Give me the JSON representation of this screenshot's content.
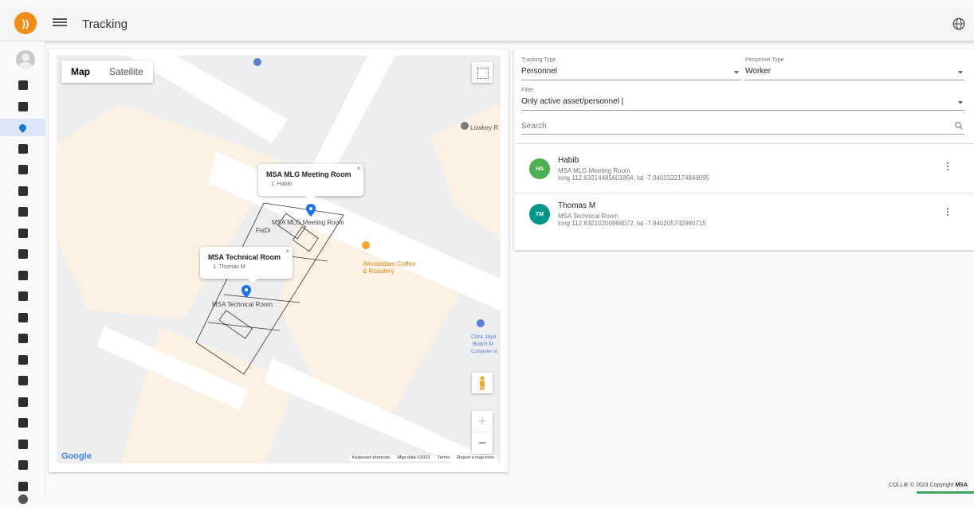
{
  "header": {
    "title": "Tracking",
    "logo_text": "))",
    "menu_icon": "hamburger-menu-icon",
    "language_icon": "globe-icon"
  },
  "sidebar": {
    "items": [
      {
        "icon": "dashboard-icon",
        "active": false
      },
      {
        "icon": "monitor-icon",
        "active": false
      },
      {
        "icon": "location-pin-icon",
        "active": true
      },
      {
        "icon": "floor-plan-icon",
        "active": false
      },
      {
        "icon": "group-icon",
        "active": false
      },
      {
        "icon": "database-icon",
        "active": false
      },
      {
        "icon": "library-icon",
        "active": false
      },
      {
        "icon": "building-icon",
        "active": false
      },
      {
        "icon": "zone-icon",
        "active": false
      },
      {
        "icon": "person-icon",
        "active": false
      },
      {
        "icon": "org-icon",
        "active": false
      },
      {
        "icon": "apartment-icon",
        "active": false
      },
      {
        "icon": "device-icon",
        "active": false
      },
      {
        "icon": "support-icon",
        "active": false
      },
      {
        "icon": "person-check-icon",
        "active": false
      },
      {
        "icon": "person-alert-icon",
        "active": false
      },
      {
        "icon": "person-settings-icon",
        "active": false
      },
      {
        "icon": "people-icon",
        "active": false
      },
      {
        "icon": "walking-icon",
        "active": false
      },
      {
        "icon": "person-more-icon",
        "active": false
      },
      {
        "icon": "help-icon",
        "active": false
      }
    ],
    "accent": "#1976d2"
  },
  "map": {
    "type_options": [
      "Map",
      "Satellite"
    ],
    "selected_type": "Map",
    "popups": [
      {
        "title": "MSA MLG Meeting Room",
        "subtitle": "1. Habib",
        "close": "×"
      },
      {
        "title": "MSA Technical Room",
        "subtitle": "1. Thomas M",
        "close": "×"
      }
    ],
    "labels": {
      "meeting_room": "MSA MLG Meeting Room",
      "technical_room": "MSA Technical Room",
      "fixdi": "FixDi",
      "lowkey": "Lowkey R",
      "amsterdam_1": "Amsterdam Coffee",
      "amsterdam_2": "& Roastery",
      "citra_1": "Citra Jaya",
      "citra_2": "Brach M",
      "citra_3": "Computer st"
    },
    "zoom_in": "+",
    "zoom_out": "−",
    "google_logo": "Google",
    "attribution": {
      "shortcuts": "Keyboard shortcuts",
      "data": "Map data ©2023",
      "terms": "Terms",
      "report": "Report a map error"
    }
  },
  "panel": {
    "tracking_type": {
      "label": "Tracking Type",
      "value": "Personnel"
    },
    "personnel_type": {
      "label": "Personnel Type",
      "value": "Worker"
    },
    "filter": {
      "label": "Filter",
      "value": "Only active asset/personnel |"
    },
    "search": {
      "placeholder": "Search"
    },
    "people": [
      {
        "initials": "HA",
        "name": "Habib",
        "location": "MSA MLG Meeting Room",
        "coords": "long 112.63214485601864, lat -7.9401522174849095",
        "color": "#4caf50"
      },
      {
        "initials": "TM",
        "name": "Thomas M",
        "location": "MSA Technical Room",
        "coords": "long 112.63210200868072, lat -7.940205742980715",
        "color": "#009688"
      }
    ]
  },
  "footer": {
    "text": "COLLIE © 2023 Copyright",
    "brand": "MSA"
  }
}
